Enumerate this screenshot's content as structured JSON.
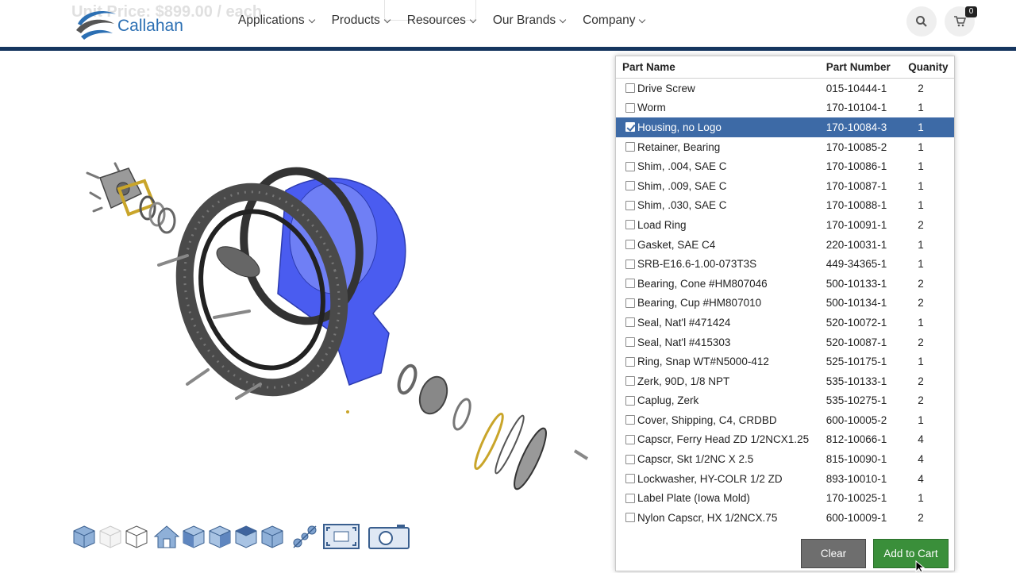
{
  "header": {
    "ghost_price": "Unit Price: $899.00 / each",
    "logo_text": "Callahan",
    "cart_count": "0",
    "nav": [
      {
        "label": "Applications"
      },
      {
        "label": "Products"
      },
      {
        "label": "Resources"
      },
      {
        "label": "Our Brands"
      },
      {
        "label": "Company"
      }
    ]
  },
  "colors": {
    "brand_navy": "#16365f",
    "logo_blue": "#2b6fb3",
    "selected_row": "#3d6aa6",
    "add_to_cart": "#3a8f3a",
    "clear_button": "#6e6e6e",
    "highlighted_part": "#4a5cf0"
  },
  "parts_table": {
    "headers": {
      "name": "Part Name",
      "number": "Part Number",
      "quantity": "Quanity"
    },
    "rows": [
      {
        "name": "Drive Screw",
        "number": "015-10444-1",
        "qty": "2",
        "checked": false
      },
      {
        "name": "Worm",
        "number": "170-10104-1",
        "qty": "1",
        "checked": false
      },
      {
        "name": "Housing, no Logo",
        "number": "170-10084-3",
        "qty": "1",
        "checked": true
      },
      {
        "name": "Retainer, Bearing",
        "number": "170-10085-2",
        "qty": "1",
        "checked": false
      },
      {
        "name": "Shim, .004, SAE C",
        "number": "170-10086-1",
        "qty": "1",
        "checked": false
      },
      {
        "name": "Shim, .009, SAE C",
        "number": "170-10087-1",
        "qty": "1",
        "checked": false
      },
      {
        "name": "Shim, .030, SAE C",
        "number": "170-10088-1",
        "qty": "1",
        "checked": false
      },
      {
        "name": "Load Ring",
        "number": "170-10091-1",
        "qty": "2",
        "checked": false
      },
      {
        "name": "Gasket, SAE C4",
        "number": "220-10031-1",
        "qty": "1",
        "checked": false
      },
      {
        "name": "SRB-E16.6-1.00-073T3S",
        "number": "449-34365-1",
        "qty": "1",
        "checked": false
      },
      {
        "name": "Bearing, Cone #HM807046",
        "number": "500-10133-1",
        "qty": "2",
        "checked": false
      },
      {
        "name": "Bearing, Cup #HM807010",
        "number": "500-10134-1",
        "qty": "2",
        "checked": false
      },
      {
        "name": "Seal, Nat'l #471424",
        "number": "520-10072-1",
        "qty": "1",
        "checked": false
      },
      {
        "name": "Seal, Nat'l #415303",
        "number": "520-10087-1",
        "qty": "2",
        "checked": false
      },
      {
        "name": "Ring, Snap WT#N5000-412",
        "number": "525-10175-1",
        "qty": "1",
        "checked": false
      },
      {
        "name": "Zerk, 90D, 1/8 NPT",
        "number": "535-10133-1",
        "qty": "2",
        "checked": false
      },
      {
        "name": "Caplug, Zerk",
        "number": "535-10275-1",
        "qty": "2",
        "checked": false
      },
      {
        "name": "Cover, Shipping, C4, CRDBD",
        "number": "600-10005-2",
        "qty": "1",
        "checked": false
      },
      {
        "name": "Capscr, Ferry Head ZD 1/2NCX1.25",
        "number": "812-10066-1",
        "qty": "4",
        "checked": false
      },
      {
        "name": "Capscr, Skt 1/2NC X 2.5",
        "number": "815-10090-1",
        "qty": "4",
        "checked": false
      },
      {
        "name": "Lockwasher, HY-COLR 1/2 ZD",
        "number": "893-10010-1",
        "qty": "4",
        "checked": false
      },
      {
        "name": "Label Plate (Iowa Mold)",
        "number": "170-10025-1",
        "qty": "1",
        "checked": false
      },
      {
        "name": "Nylon Capscr, HX 1/2NCX.75",
        "number": "600-10009-1",
        "qty": "2",
        "checked": false
      }
    ]
  },
  "buttons": {
    "clear": "Clear",
    "add_to_cart": "Add to Cart"
  },
  "toolbar": [
    {
      "icon": "solid-cube-icon"
    },
    {
      "icon": "transparent-cube-icon"
    },
    {
      "icon": "wireframe-cube-icon"
    },
    {
      "icon": "home-view-icon"
    },
    {
      "icon": "front-view-icon"
    },
    {
      "icon": "right-view-icon"
    },
    {
      "icon": "left-view-icon"
    },
    {
      "icon": "top-view-icon"
    },
    {
      "icon": "explode-icon"
    },
    {
      "icon": "fit-view-icon"
    },
    {
      "icon": "camera-icon"
    }
  ]
}
